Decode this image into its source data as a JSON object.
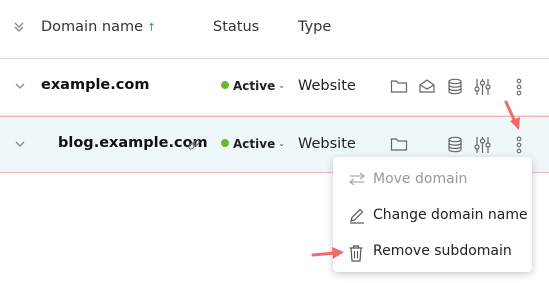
{
  "header": {
    "domain_col": "Domain name",
    "sort_indicator": "↑",
    "status_col": "Status",
    "type_col": "Type"
  },
  "rows": [
    {
      "name": "example.com",
      "status": "Active",
      "type": "Website",
      "actions": [
        "folder-icon",
        "mail-icon",
        "database-icon",
        "settings-sliders-icon",
        "more-options-icon"
      ]
    },
    {
      "name": "blog.example.com",
      "status": "Active",
      "type": "Website",
      "actions": [
        "link-icon",
        "folder-icon",
        "database-icon",
        "settings-sliders-icon",
        "more-options-icon"
      ]
    }
  ],
  "context_menu": {
    "items": [
      {
        "label": "Move domain",
        "icon": "move-arrows-icon",
        "disabled": true
      },
      {
        "label": "Change domain name",
        "icon": "pencil-icon",
        "disabled": false
      },
      {
        "label": "Remove subdomain",
        "icon": "trash-icon",
        "disabled": false
      }
    ]
  },
  "colors": {
    "accent": "#2a8bd8",
    "active_dot": "#6bb82a",
    "highlight_row": "#eef8fb",
    "annotation_arrow": "#f06a6a"
  }
}
